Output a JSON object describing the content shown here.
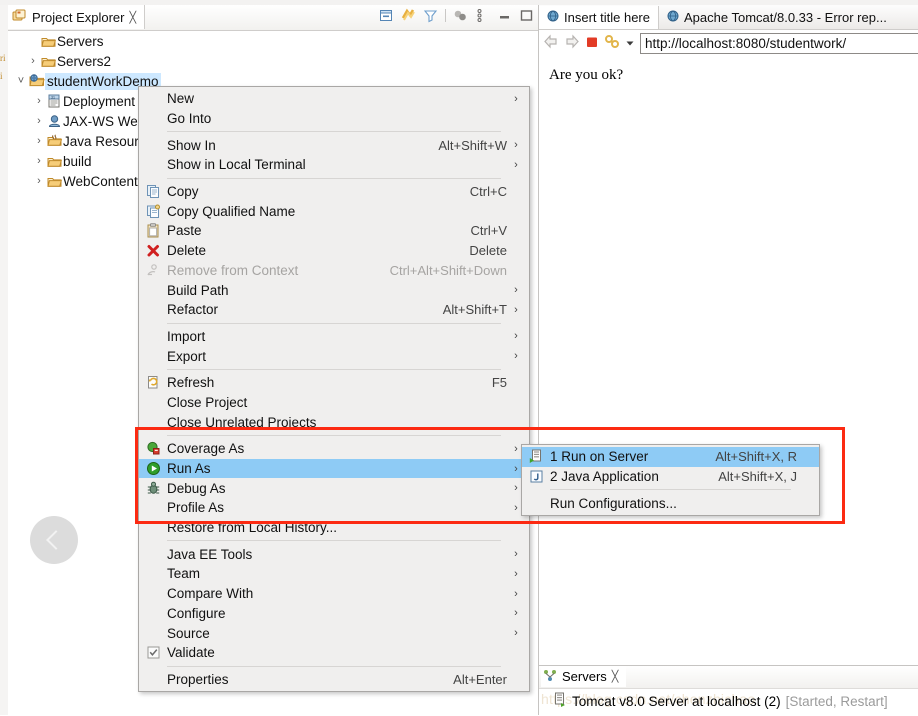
{
  "colors": {
    "menu_bg": "#f0efee",
    "menu_border": "#a9a7a5",
    "highlight": "#8ecbf5",
    "tree_selection": "#cde8ff",
    "annotation_red": "#fc2a12",
    "disabled_text": "#a6a4a2",
    "server_state_text": "#9b9b9b",
    "watermark": "#efe4d2"
  },
  "explorer": {
    "tab_label": "Project Explorer",
    "tab_close": "╳",
    "toolbar_icons": [
      "collapse-all-icon",
      "link-with-editor-icon",
      "view-filter-icon",
      "separator",
      "working-set-icon",
      "view-menu-icon",
      "minimize-icon",
      "maximize-icon"
    ],
    "tree": [
      {
        "label": "Servers",
        "indent": 1,
        "arrow": "",
        "icon": "folder-icon",
        "selected": false
      },
      {
        "label": "Servers2",
        "indent": 1,
        "arrow": "›",
        "icon": "folder-icon",
        "selected": false
      },
      {
        "label": "studentWorkDemo",
        "indent": 0,
        "arrow": "˅",
        "icon": "web-project-icon",
        "selected": true
      },
      {
        "label": "Deployment",
        "indent": 2,
        "arrow": "›",
        "icon": "deployment-descriptor-icon",
        "selected": false
      },
      {
        "label": "JAX-WS Web",
        "indent": 2,
        "arrow": "›",
        "icon": "jaxws-icon",
        "selected": false
      },
      {
        "label": "Java Resourc",
        "indent": 2,
        "arrow": "›",
        "icon": "java-resources-icon",
        "selected": false
      },
      {
        "label": "build",
        "indent": 2,
        "arrow": "›",
        "icon": "folder-icon",
        "selected": false
      },
      {
        "label": "WebContent",
        "indent": 2,
        "arrow": "›",
        "icon": "folder-icon",
        "selected": false
      }
    ]
  },
  "context_menu": {
    "items": [
      {
        "type": "item",
        "label": "New",
        "accel": "",
        "arrow": true,
        "icon": "",
        "disabled": false,
        "highlighted": false
      },
      {
        "type": "item",
        "label": "Go Into",
        "accel": "",
        "arrow": false,
        "icon": "",
        "disabled": false,
        "highlighted": false
      },
      {
        "type": "sep"
      },
      {
        "type": "item",
        "label": "Show In",
        "accel": "Alt+Shift+W",
        "arrow": true,
        "icon": "",
        "disabled": false,
        "highlighted": false
      },
      {
        "type": "item",
        "label": "Show in Local Terminal",
        "accel": "",
        "arrow": true,
        "icon": "",
        "disabled": false,
        "highlighted": false
      },
      {
        "type": "sep"
      },
      {
        "type": "item",
        "label": "Copy",
        "accel": "Ctrl+C",
        "arrow": false,
        "icon": "copy-icon",
        "disabled": false,
        "highlighted": false
      },
      {
        "type": "item",
        "label": "Copy Qualified Name",
        "accel": "",
        "arrow": false,
        "icon": "copy-qualified-icon",
        "disabled": false,
        "highlighted": false
      },
      {
        "type": "item",
        "label": "Paste",
        "accel": "Ctrl+V",
        "arrow": false,
        "icon": "paste-icon",
        "disabled": false,
        "highlighted": false
      },
      {
        "type": "item",
        "label": "Delete",
        "accel": "Delete",
        "arrow": false,
        "icon": "delete-x-icon",
        "disabled": false,
        "highlighted": false
      },
      {
        "type": "item",
        "label": "Remove from Context",
        "accel": "Ctrl+Alt+Shift+Down",
        "arrow": false,
        "icon": "remove-context-icon",
        "disabled": true,
        "highlighted": false
      },
      {
        "type": "item",
        "label": "Build Path",
        "accel": "",
        "arrow": true,
        "icon": "",
        "disabled": false,
        "highlighted": false
      },
      {
        "type": "item",
        "label": "Refactor",
        "accel": "Alt+Shift+T",
        "arrow": true,
        "icon": "",
        "disabled": false,
        "highlighted": false
      },
      {
        "type": "sep"
      },
      {
        "type": "item",
        "label": "Import",
        "accel": "",
        "arrow": true,
        "icon": "",
        "disabled": false,
        "highlighted": false
      },
      {
        "type": "item",
        "label": "Export",
        "accel": "",
        "arrow": true,
        "icon": "",
        "disabled": false,
        "highlighted": false
      },
      {
        "type": "sep"
      },
      {
        "type": "item",
        "label": "Refresh",
        "accel": "F5",
        "arrow": false,
        "icon": "refresh-icon",
        "disabled": false,
        "highlighted": false
      },
      {
        "type": "item",
        "label": "Close Project",
        "accel": "",
        "arrow": false,
        "icon": "",
        "disabled": false,
        "highlighted": false
      },
      {
        "type": "item",
        "label": "Close Unrelated Projects",
        "accel": "",
        "arrow": false,
        "icon": "",
        "disabled": false,
        "highlighted": false
      },
      {
        "type": "sep"
      },
      {
        "type": "item",
        "label": "Coverage As",
        "accel": "",
        "arrow": true,
        "icon": "coverage-icon",
        "disabled": false,
        "highlighted": false
      },
      {
        "type": "item",
        "label": "Run As",
        "accel": "",
        "arrow": true,
        "icon": "run-icon",
        "disabled": false,
        "highlighted": true
      },
      {
        "type": "item",
        "label": "Debug As",
        "accel": "",
        "arrow": true,
        "icon": "debug-icon",
        "disabled": false,
        "highlighted": false
      },
      {
        "type": "item",
        "label": "Profile As",
        "accel": "",
        "arrow": true,
        "icon": "",
        "disabled": false,
        "highlighted": false
      },
      {
        "type": "item",
        "label": "Restore from Local History...",
        "accel": "",
        "arrow": false,
        "icon": "",
        "disabled": false,
        "highlighted": false
      },
      {
        "type": "sep"
      },
      {
        "type": "item",
        "label": "Java EE Tools",
        "accel": "",
        "arrow": true,
        "icon": "",
        "disabled": false,
        "highlighted": false
      },
      {
        "type": "item",
        "label": "Team",
        "accel": "",
        "arrow": true,
        "icon": "",
        "disabled": false,
        "highlighted": false
      },
      {
        "type": "item",
        "label": "Compare With",
        "accel": "",
        "arrow": true,
        "icon": "",
        "disabled": false,
        "highlighted": false
      },
      {
        "type": "item",
        "label": "Configure",
        "accel": "",
        "arrow": true,
        "icon": "",
        "disabled": false,
        "highlighted": false
      },
      {
        "type": "item",
        "label": "Source",
        "accel": "",
        "arrow": true,
        "icon": "",
        "disabled": false,
        "highlighted": false
      },
      {
        "type": "item",
        "label": "Validate",
        "accel": "",
        "arrow": false,
        "icon": "checkbox-checked-icon",
        "disabled": false,
        "highlighted": false
      },
      {
        "type": "sep"
      },
      {
        "type": "item",
        "label": "Properties",
        "accel": "Alt+Enter",
        "arrow": false,
        "icon": "",
        "disabled": false,
        "highlighted": false
      }
    ]
  },
  "run_as_submenu": {
    "items": [
      {
        "type": "item",
        "label": "1 Run on Server",
        "accel": "Alt+Shift+X, R",
        "icon": "run-on-server-icon",
        "highlighted": true
      },
      {
        "type": "item",
        "label": "2 Java Application",
        "accel": "Alt+Shift+X, J",
        "icon": "java-app-icon",
        "highlighted": false
      },
      {
        "type": "sep"
      },
      {
        "type": "item",
        "label": "Run Configurations...",
        "accel": "",
        "icon": "",
        "highlighted": false
      }
    ]
  },
  "browser": {
    "tabs": [
      {
        "label": "Insert title here",
        "icon": "globe-icon",
        "active": true
      },
      {
        "label": "Apache Tomcat/8.0.33 - Error rep...",
        "icon": "globe-icon",
        "active": false
      }
    ],
    "toolbar": {
      "back_icon": "back-arrow-icon",
      "forward_icon": "forward-arrow-icon",
      "stop_icon": "stop-icon",
      "bookmark_icon": "bookmarks-icon",
      "dropdown_icon": "chevron-down-icon"
    },
    "url": "http://localhost:8080/studentwork/",
    "page_text": "Are you ok?"
  },
  "servers_view": {
    "tab_label": "Servers",
    "tab_close": "╳",
    "server_name": "Tomcat v8.0 Server at localhost (2)",
    "server_state": "[Started, Restart]",
    "watermark": "https://blog.csdn.net/chenzhichao"
  },
  "nav_overlay": {
    "back_icon": "chevron-left-icon"
  }
}
